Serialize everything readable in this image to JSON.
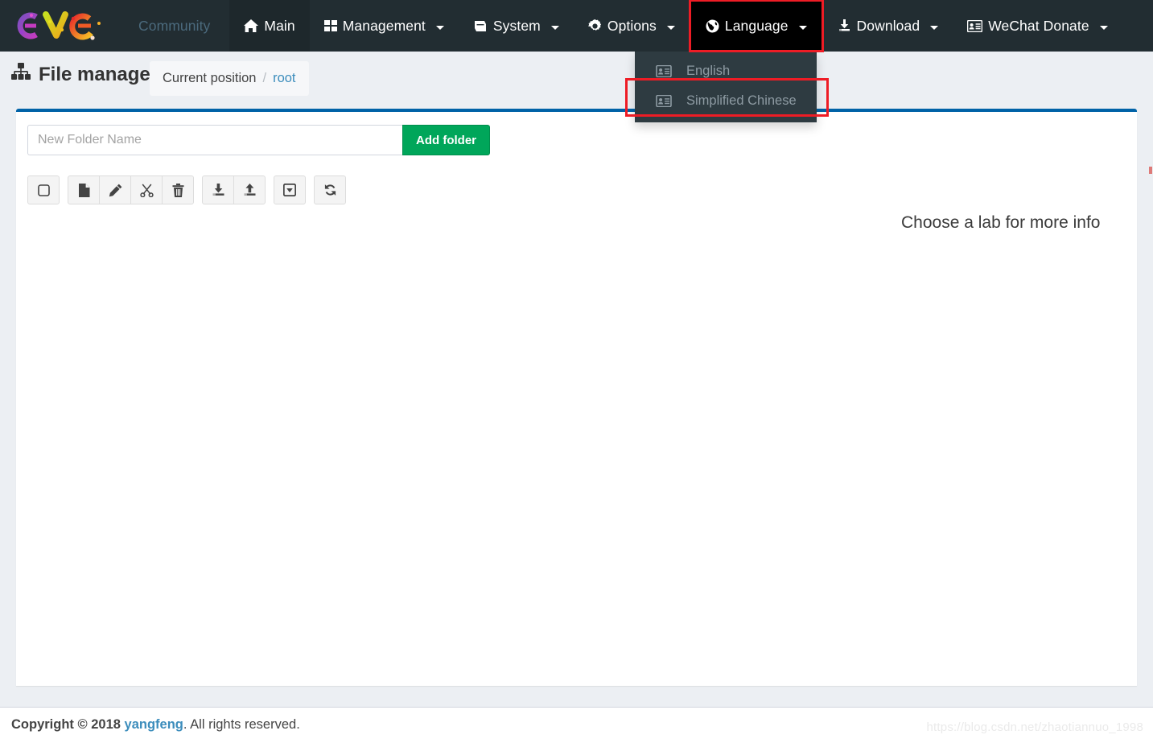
{
  "navbar": {
    "brand": {
      "logo_alt": "eve-ng-logo"
    },
    "items": [
      {
        "label": "Community",
        "icon": "",
        "caret": false,
        "style": "community"
      },
      {
        "label": "Main",
        "icon": "home-icon",
        "caret": false,
        "style": "active"
      },
      {
        "label": "Management",
        "icon": "grid-icon",
        "caret": true,
        "style": "normal"
      },
      {
        "label": "System",
        "icon": "book-icon",
        "caret": true,
        "style": "normal"
      },
      {
        "label": "Options",
        "icon": "gear-icon",
        "caret": true,
        "style": "normal"
      },
      {
        "label": "Language",
        "icon": "globe-icon",
        "caret": true,
        "style": "open-highlighted"
      },
      {
        "label": "Download",
        "icon": "download-icon",
        "caret": true,
        "style": "normal"
      },
      {
        "label": "WeChat Donate",
        "icon": "id-card-icon",
        "caret": true,
        "style": "normal"
      }
    ],
    "background_color": "#222d32",
    "highlight_color": "#ee1c25"
  },
  "language_dropdown": {
    "open": true,
    "items": [
      {
        "label": "English",
        "icon": "id-card-icon",
        "highlighted": false
      },
      {
        "label": "Simplified Chinese",
        "icon": "id-card-icon",
        "highlighted": true
      }
    ]
  },
  "content_header": {
    "title": "File manager",
    "title_icon": "sitemap-icon",
    "breadcrumb": {
      "label": "Current position",
      "separator": "/",
      "current": "root"
    }
  },
  "panel": {
    "accent_color": "#0062a7",
    "new_folder": {
      "placeholder": "New Folder Name",
      "value": "",
      "button_label": "Add folder",
      "button_color": "#00a65a"
    },
    "toolbar": [
      {
        "name": "select-all-checkbox",
        "icon": "square-icon",
        "group": 0
      },
      {
        "name": "new-file-button",
        "icon": "file-icon",
        "group": 1
      },
      {
        "name": "rename-button",
        "icon": "pencil-icon",
        "group": 1
      },
      {
        "name": "cut-button",
        "icon": "scissors-icon",
        "group": 1
      },
      {
        "name": "delete-button",
        "icon": "trash-icon",
        "group": 1
      },
      {
        "name": "download-button",
        "icon": "download-tray-icon",
        "group": 2
      },
      {
        "name": "upload-button",
        "icon": "upload-tray-icon",
        "group": 2
      },
      {
        "name": "archive-button",
        "icon": "caret-square-down-icon",
        "group": 3
      },
      {
        "name": "refresh-button",
        "icon": "refresh-icon",
        "group": 4
      }
    ],
    "lab_info_text": "Choose a lab for more info"
  },
  "footer": {
    "copyright_prefix": "Copyright © 2018",
    "author": "yangfeng",
    "copyright_suffix": ". All rights reserved.",
    "watermark": "https://blog.csdn.net/zhaotiannuo_1998"
  }
}
